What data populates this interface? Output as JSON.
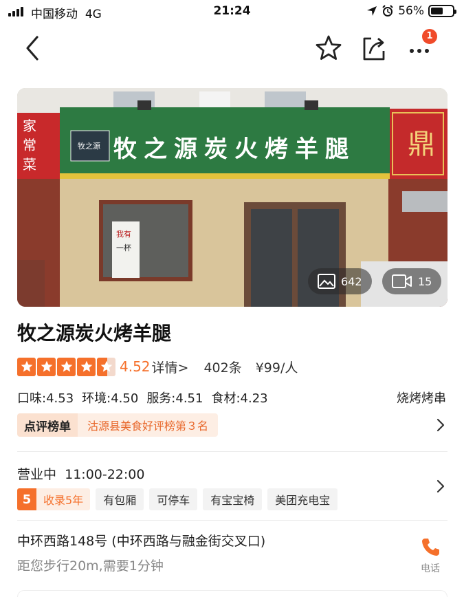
{
  "status_bar": {
    "carrier": "中国移动",
    "network": "4G",
    "time": "21:24",
    "battery_percent": "56%",
    "battery_level": 0.56
  },
  "nav": {
    "badge_count": "1",
    "icons": [
      "back-arrow-icon",
      "star-outline-icon",
      "share-icon",
      "more-dots-icon"
    ]
  },
  "hero": {
    "sign_text": "牧之源炭火烤羊腿",
    "left_sign": "家常菜",
    "right_sign": "鼎",
    "door_sign": "我有一杯",
    "logo_text": "牧之源",
    "photos_count": "642",
    "videos_count": "15"
  },
  "shop": {
    "name": "牧之源炭火烤羊腿",
    "stars": 4.5,
    "score": "4.52",
    "detail_label": "详情>",
    "review_count": "402条",
    "price": "¥99/人",
    "sub_scores": [
      "口味:4.53",
      "环境:4.50",
      "服务:4.51",
      "食材:4.23"
    ],
    "category": "烧烤烤串",
    "rank_tag": "点评榜单",
    "rank_text": "沽源县美食好评榜第３名"
  },
  "hours": {
    "status": "营业中",
    "time": "11:00-22:00",
    "years_num": "5",
    "years_text": "收录5年",
    "facilities": [
      "有包厢",
      "可停车",
      "有宝宝椅",
      "美团充电宝"
    ]
  },
  "address": {
    "street": "中环西路148号 (中环西路与融金街交叉口)",
    "distance": "距您步行20m,需要1分钟",
    "phone_label": "电话"
  },
  "colors": {
    "accent": "#f5702b",
    "badge": "#f04b2a",
    "sign_green": "#2d7a42"
  }
}
